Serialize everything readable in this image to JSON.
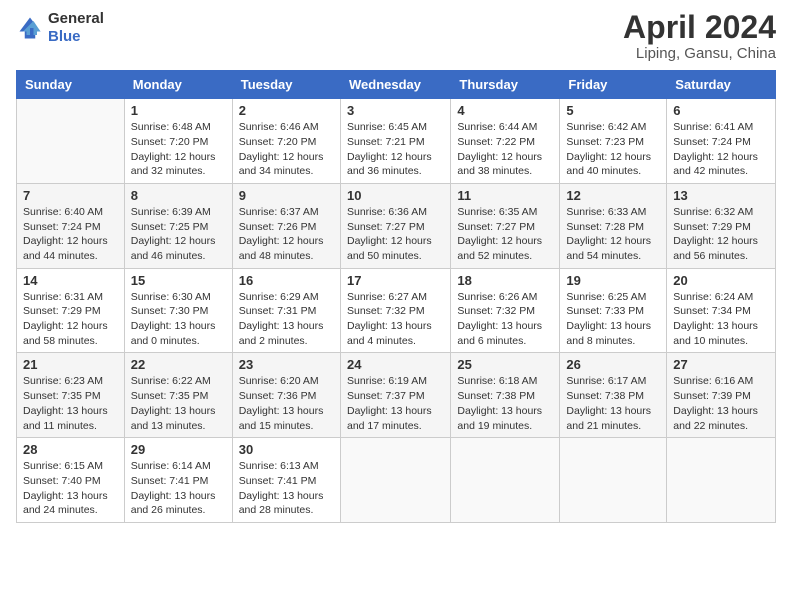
{
  "logo": {
    "line1": "General",
    "line2": "Blue"
  },
  "title": {
    "month_year": "April 2024",
    "location": "Liping, Gansu, China"
  },
  "days_of_week": [
    "Sunday",
    "Monday",
    "Tuesday",
    "Wednesday",
    "Thursday",
    "Friday",
    "Saturday"
  ],
  "weeks": [
    [
      {
        "day": "",
        "info": ""
      },
      {
        "day": "1",
        "info": "Sunrise: 6:48 AM\nSunset: 7:20 PM\nDaylight: 12 hours\nand 32 minutes."
      },
      {
        "day": "2",
        "info": "Sunrise: 6:46 AM\nSunset: 7:20 PM\nDaylight: 12 hours\nand 34 minutes."
      },
      {
        "day": "3",
        "info": "Sunrise: 6:45 AM\nSunset: 7:21 PM\nDaylight: 12 hours\nand 36 minutes."
      },
      {
        "day": "4",
        "info": "Sunrise: 6:44 AM\nSunset: 7:22 PM\nDaylight: 12 hours\nand 38 minutes."
      },
      {
        "day": "5",
        "info": "Sunrise: 6:42 AM\nSunset: 7:23 PM\nDaylight: 12 hours\nand 40 minutes."
      },
      {
        "day": "6",
        "info": "Sunrise: 6:41 AM\nSunset: 7:24 PM\nDaylight: 12 hours\nand 42 minutes."
      }
    ],
    [
      {
        "day": "7",
        "info": "Sunrise: 6:40 AM\nSunset: 7:24 PM\nDaylight: 12 hours\nand 44 minutes."
      },
      {
        "day": "8",
        "info": "Sunrise: 6:39 AM\nSunset: 7:25 PM\nDaylight: 12 hours\nand 46 minutes."
      },
      {
        "day": "9",
        "info": "Sunrise: 6:37 AM\nSunset: 7:26 PM\nDaylight: 12 hours\nand 48 minutes."
      },
      {
        "day": "10",
        "info": "Sunrise: 6:36 AM\nSunset: 7:27 PM\nDaylight: 12 hours\nand 50 minutes."
      },
      {
        "day": "11",
        "info": "Sunrise: 6:35 AM\nSunset: 7:27 PM\nDaylight: 12 hours\nand 52 minutes."
      },
      {
        "day": "12",
        "info": "Sunrise: 6:33 AM\nSunset: 7:28 PM\nDaylight: 12 hours\nand 54 minutes."
      },
      {
        "day": "13",
        "info": "Sunrise: 6:32 AM\nSunset: 7:29 PM\nDaylight: 12 hours\nand 56 minutes."
      }
    ],
    [
      {
        "day": "14",
        "info": "Sunrise: 6:31 AM\nSunset: 7:29 PM\nDaylight: 12 hours\nand 58 minutes."
      },
      {
        "day": "15",
        "info": "Sunrise: 6:30 AM\nSunset: 7:30 PM\nDaylight: 13 hours\nand 0 minutes."
      },
      {
        "day": "16",
        "info": "Sunrise: 6:29 AM\nSunset: 7:31 PM\nDaylight: 13 hours\nand 2 minutes."
      },
      {
        "day": "17",
        "info": "Sunrise: 6:27 AM\nSunset: 7:32 PM\nDaylight: 13 hours\nand 4 minutes."
      },
      {
        "day": "18",
        "info": "Sunrise: 6:26 AM\nSunset: 7:32 PM\nDaylight: 13 hours\nand 6 minutes."
      },
      {
        "day": "19",
        "info": "Sunrise: 6:25 AM\nSunset: 7:33 PM\nDaylight: 13 hours\nand 8 minutes."
      },
      {
        "day": "20",
        "info": "Sunrise: 6:24 AM\nSunset: 7:34 PM\nDaylight: 13 hours\nand 10 minutes."
      }
    ],
    [
      {
        "day": "21",
        "info": "Sunrise: 6:23 AM\nSunset: 7:35 PM\nDaylight: 13 hours\nand 11 minutes."
      },
      {
        "day": "22",
        "info": "Sunrise: 6:22 AM\nSunset: 7:35 PM\nDaylight: 13 hours\nand 13 minutes."
      },
      {
        "day": "23",
        "info": "Sunrise: 6:20 AM\nSunset: 7:36 PM\nDaylight: 13 hours\nand 15 minutes."
      },
      {
        "day": "24",
        "info": "Sunrise: 6:19 AM\nSunset: 7:37 PM\nDaylight: 13 hours\nand 17 minutes."
      },
      {
        "day": "25",
        "info": "Sunrise: 6:18 AM\nSunset: 7:38 PM\nDaylight: 13 hours\nand 19 minutes."
      },
      {
        "day": "26",
        "info": "Sunrise: 6:17 AM\nSunset: 7:38 PM\nDaylight: 13 hours\nand 21 minutes."
      },
      {
        "day": "27",
        "info": "Sunrise: 6:16 AM\nSunset: 7:39 PM\nDaylight: 13 hours\nand 22 minutes."
      }
    ],
    [
      {
        "day": "28",
        "info": "Sunrise: 6:15 AM\nSunset: 7:40 PM\nDaylight: 13 hours\nand 24 minutes."
      },
      {
        "day": "29",
        "info": "Sunrise: 6:14 AM\nSunset: 7:41 PM\nDaylight: 13 hours\nand 26 minutes."
      },
      {
        "day": "30",
        "info": "Sunrise: 6:13 AM\nSunset: 7:41 PM\nDaylight: 13 hours\nand 28 minutes."
      },
      {
        "day": "",
        "info": ""
      },
      {
        "day": "",
        "info": ""
      },
      {
        "day": "",
        "info": ""
      },
      {
        "day": "",
        "info": ""
      }
    ]
  ]
}
